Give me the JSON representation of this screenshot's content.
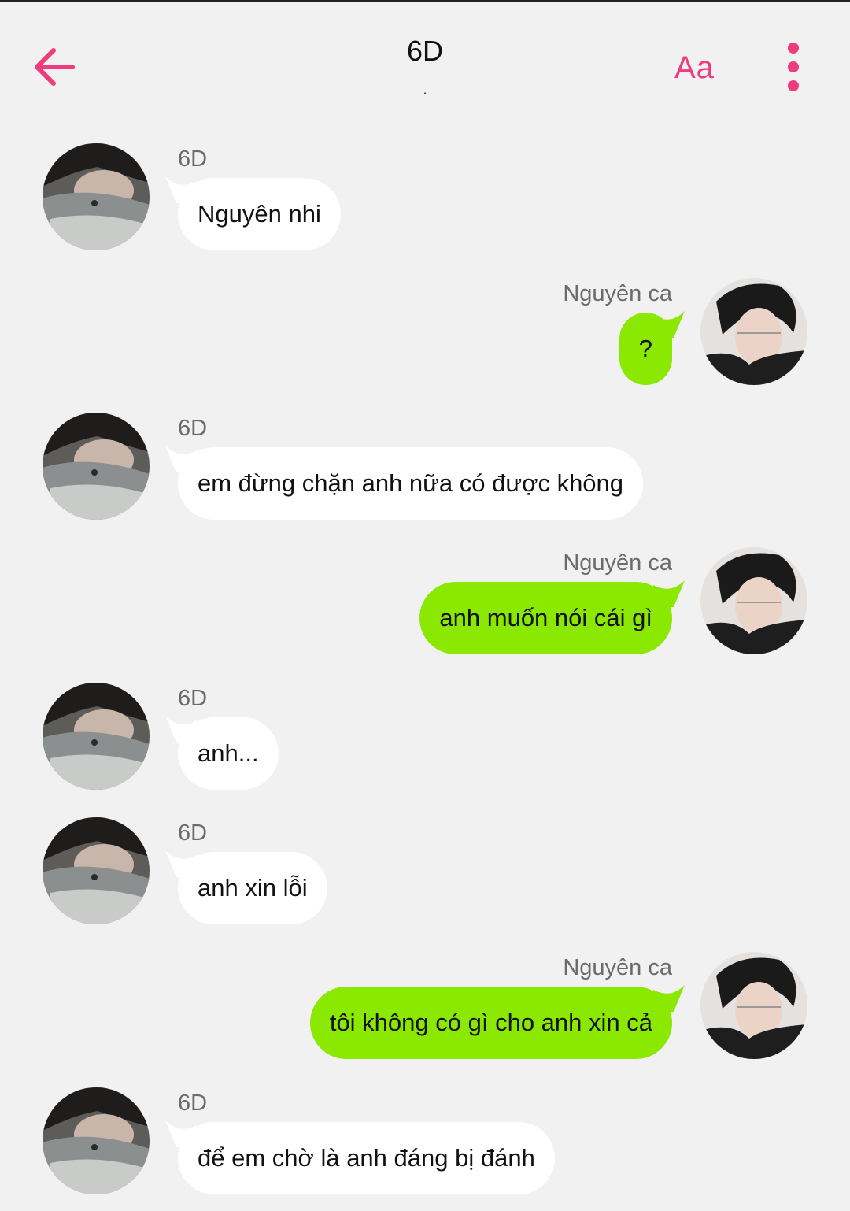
{
  "header": {
    "title": "6D",
    "subtitle": ".",
    "font_button_label": "Aa",
    "accent_color": "#ee3d7e"
  },
  "colors": {
    "background": "#f1f1f1",
    "incoming_bubble": "#ffffff",
    "outgoing_bubble": "#8be800"
  },
  "messages": [
    {
      "side": "left",
      "sender": "6D",
      "text": "Nguyên nhi"
    },
    {
      "side": "right",
      "sender": "Nguyên ca",
      "text": "?"
    },
    {
      "side": "left",
      "sender": "6D",
      "text": "em đừng chặn anh nữa có được không"
    },
    {
      "side": "right",
      "sender": "Nguyên ca",
      "text": "anh muốn nói cái gì"
    },
    {
      "side": "left",
      "sender": "6D",
      "text": "anh..."
    },
    {
      "side": "left",
      "sender": "6D",
      "text": "anh xin lỗi"
    },
    {
      "side": "right",
      "sender": "Nguyên ca",
      "text": "tôi không có gì cho anh xin cả"
    },
    {
      "side": "left",
      "sender": "6D",
      "text": "để em chờ là anh đáng bị đánh"
    }
  ]
}
